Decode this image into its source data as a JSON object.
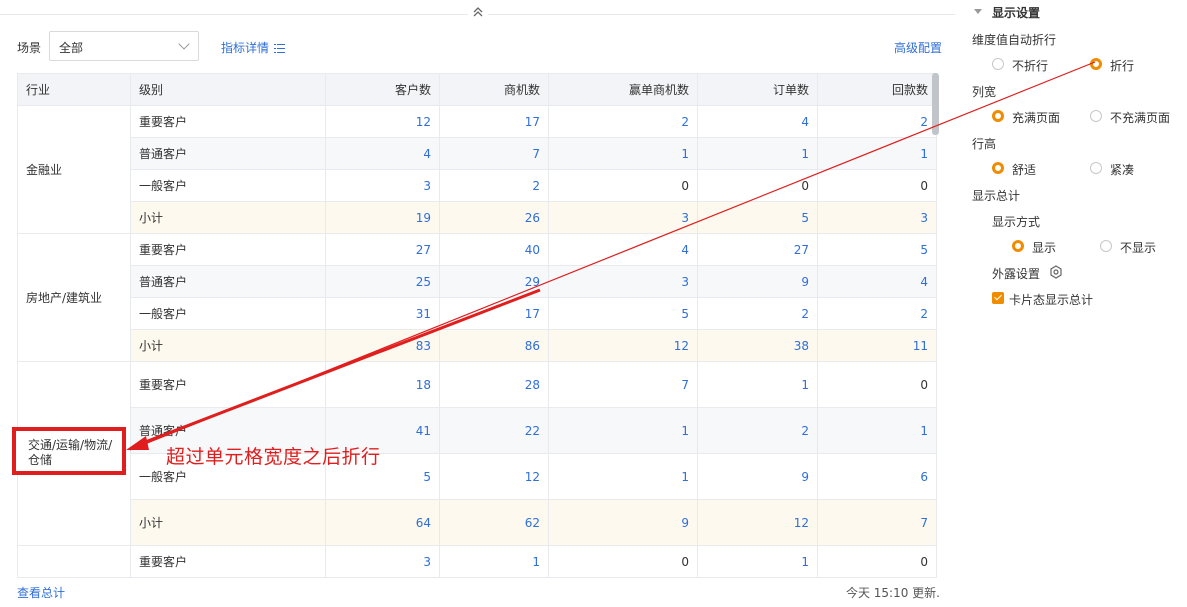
{
  "collapse_icon": "chevron-double-up-icon",
  "toolbar": {
    "scene_label": "场景",
    "scene_value": "全部",
    "metric_link": "指标详情",
    "metric_icon": "list-icon",
    "advanced_link": "高级配置"
  },
  "table": {
    "headers": [
      "行业",
      "级别",
      "客户数",
      "商机数",
      "赢单商机数",
      "订单数",
      "回款数"
    ],
    "groups": [
      {
        "industry": "金融业",
        "rows": [
          {
            "level": "重要客户",
            "values": [
              "12",
              "17",
              "2",
              "4",
              "2"
            ],
            "linked": [
              true,
              true,
              true,
              true,
              true
            ]
          },
          {
            "level": "普通客户",
            "values": [
              "4",
              "7",
              "1",
              "1",
              "1"
            ],
            "linked": [
              true,
              true,
              true,
              true,
              true
            ]
          },
          {
            "level": "一般客户",
            "values": [
              "3",
              "2",
              "0",
              "0",
              "0"
            ],
            "linked": [
              true,
              true,
              false,
              false,
              false
            ]
          },
          {
            "level": "小计",
            "values": [
              "19",
              "26",
              "3",
              "5",
              "3"
            ],
            "linked": [
              true,
              true,
              true,
              true,
              true
            ]
          }
        ]
      },
      {
        "industry": "房地产/建筑业",
        "rows": [
          {
            "level": "重要客户",
            "values": [
              "27",
              "40",
              "4",
              "27",
              "5"
            ],
            "linked": [
              true,
              true,
              true,
              true,
              true
            ]
          },
          {
            "level": "普通客户",
            "values": [
              "25",
              "29",
              "3",
              "9",
              "4"
            ],
            "linked": [
              true,
              true,
              true,
              true,
              true
            ]
          },
          {
            "level": "一般客户",
            "values": [
              "31",
              "17",
              "5",
              "2",
              "2"
            ],
            "linked": [
              true,
              true,
              true,
              true,
              true
            ]
          },
          {
            "level": "小计",
            "values": [
              "83",
              "86",
              "12",
              "38",
              "11"
            ],
            "linked": [
              true,
              true,
              true,
              true,
              true
            ]
          }
        ]
      },
      {
        "industry": "交通/运输/物流/仓储",
        "rows": [
          {
            "level": "重要客户",
            "values": [
              "18",
              "28",
              "7",
              "1",
              "0"
            ],
            "linked": [
              true,
              true,
              true,
              true,
              false
            ]
          },
          {
            "level": "普通客户",
            "values": [
              "41",
              "22",
              "1",
              "2",
              "1"
            ],
            "linked": [
              true,
              true,
              true,
              true,
              true
            ]
          },
          {
            "level": "一般客户",
            "values": [
              "5",
              "12",
              "1",
              "9",
              "6"
            ],
            "linked": [
              true,
              true,
              true,
              true,
              true
            ]
          },
          {
            "level": "小计",
            "values": [
              "64",
              "62",
              "9",
              "12",
              "7"
            ],
            "linked": [
              true,
              true,
              true,
              true,
              true
            ]
          }
        ]
      },
      {
        "industry": "",
        "rows": [
          {
            "level": "重要客户",
            "values": [
              "3",
              "1",
              "0",
              "1",
              "0"
            ],
            "linked": [
              true,
              true,
              false,
              true,
              false
            ]
          }
        ]
      }
    ]
  },
  "footer": {
    "view_total": "查看总计",
    "update_text": "今天 15:10 更新."
  },
  "panel": {
    "title": "显示设置",
    "wrap_label": "维度值自动折行",
    "wrap_options": [
      "不折行",
      "折行"
    ],
    "wrap_selected": 1,
    "col_width_label": "列宽",
    "col_width_options": [
      "充满页面",
      "不充满页面"
    ],
    "col_width_selected": 0,
    "row_height_label": "行高",
    "row_height_options": [
      "舒适",
      "紧凑"
    ],
    "row_height_selected": 0,
    "show_total_label": "显示总计",
    "display_mode_label": "显示方式",
    "display_mode_options": [
      "显示",
      "不显示"
    ],
    "display_mode_selected": 0,
    "exposed_label": "外露设置",
    "exposed_icon": "gear-icon",
    "card_total_label": "卡片态显示总计",
    "card_total_checked": true
  },
  "annotation": {
    "text": "超过单元格宽度之后折行",
    "highlight_text": "交通/运输/物流/仓储"
  },
  "colors": {
    "link": "#2f6fd6",
    "accent": "#f08c00",
    "annotation": "#e01e1e",
    "subtotal_bg": "#fdf9ee"
  }
}
